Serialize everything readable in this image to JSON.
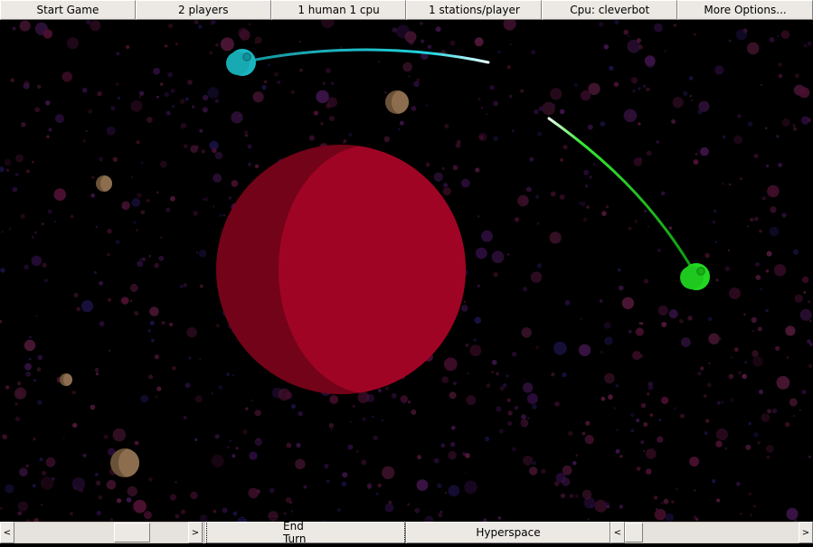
{
  "toolbar": {
    "start_game": "Start Game",
    "players": "2 players",
    "human_cpu": "1 human 1 cpu",
    "stations": "1 stations/player",
    "cpu": "Cpu: cleverbot",
    "more_options": "More Options..."
  },
  "bottom": {
    "end_turn": "End Turn",
    "hyperspace": "Hyperspace",
    "left_arrow": "<",
    "right_arrow": ">"
  },
  "colors": {
    "space": "#000000",
    "big_planet_lit": "#a00424",
    "big_planet_shadow": "#730318",
    "moon": "#8c6e4e",
    "moon_shadow": "#6a5238",
    "player_cyan": "#19b6c0",
    "player_green": "#22d822",
    "trail_cyan": "#1ec8d6",
    "trail_green": "#22cc22"
  },
  "scene": {
    "player_cyan_station": "player-cyan-station-icon",
    "player_green_station": "player-green-station-icon",
    "big_planet": "red-planet-icon",
    "moons": "moon-icon"
  }
}
